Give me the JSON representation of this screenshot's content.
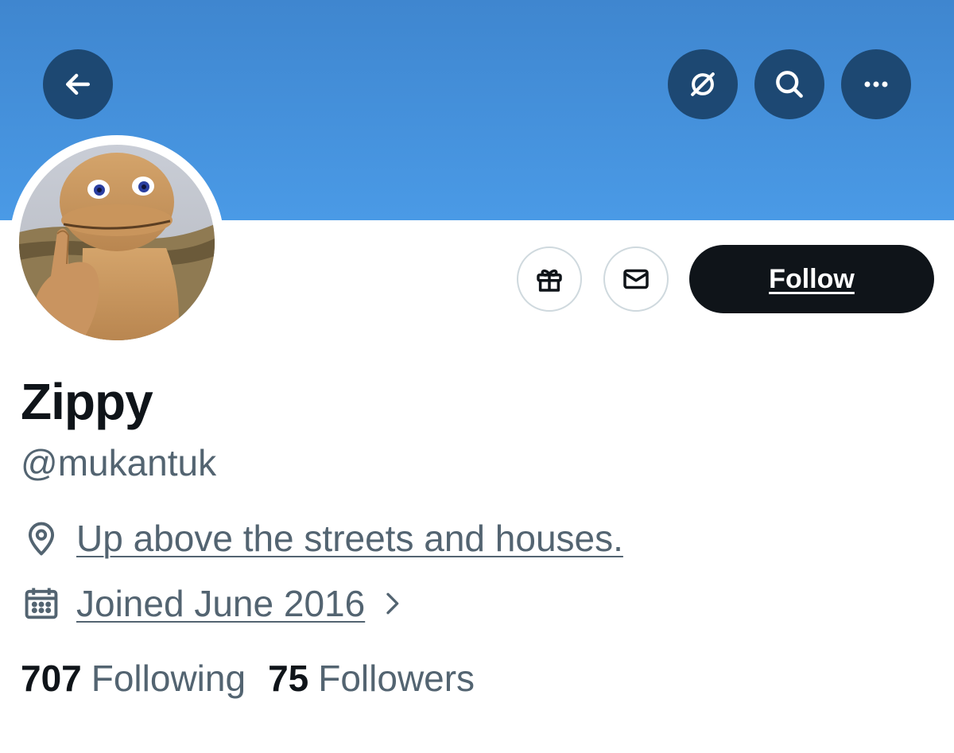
{
  "header": {
    "back_icon": "arrow-left-icon",
    "grok_icon": "grok-icon",
    "search_icon": "search-icon",
    "more_icon": "more-horizontal-icon",
    "banner_color": "#4a9ae6"
  },
  "profile": {
    "name": "Zippy",
    "handle": "@mukantuk",
    "location": "Up above the streets and houses.",
    "joined": "Joined June 2016",
    "following_count": "707",
    "following_label": "Following",
    "followers_count": "75",
    "followers_label": "Followers"
  },
  "actions": {
    "gift_icon": "gift-icon",
    "message_icon": "mail-icon",
    "follow_label": "Follow"
  }
}
